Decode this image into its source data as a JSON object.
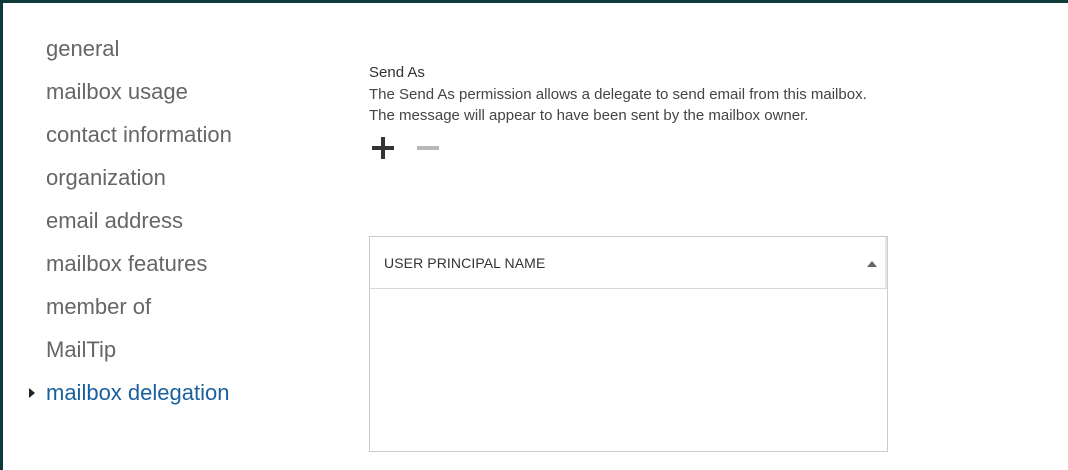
{
  "nav": {
    "items": [
      {
        "label": "general"
      },
      {
        "label": "mailbox usage"
      },
      {
        "label": "contact information"
      },
      {
        "label": "organization"
      },
      {
        "label": "email address"
      },
      {
        "label": "mailbox features"
      },
      {
        "label": "member of"
      },
      {
        "label": "MailTip"
      },
      {
        "label": "mailbox delegation",
        "active": true
      }
    ]
  },
  "send_as": {
    "title": "Send As",
    "description": "The Send As permission allows a delegate to send email from this mailbox. The message will appear to have been sent by the mailbox owner.",
    "add_icon": "plus-icon",
    "remove_icon": "minus-icon",
    "table": {
      "columns": [
        {
          "label": "USER PRINCIPAL NAME",
          "sort": "ascending"
        }
      ],
      "rows": []
    }
  },
  "colors": {
    "frame": "#0f3a3a",
    "nav_text": "#666666",
    "nav_active": "#1a5f9e",
    "remove_disabled": "#b8b8b8"
  }
}
